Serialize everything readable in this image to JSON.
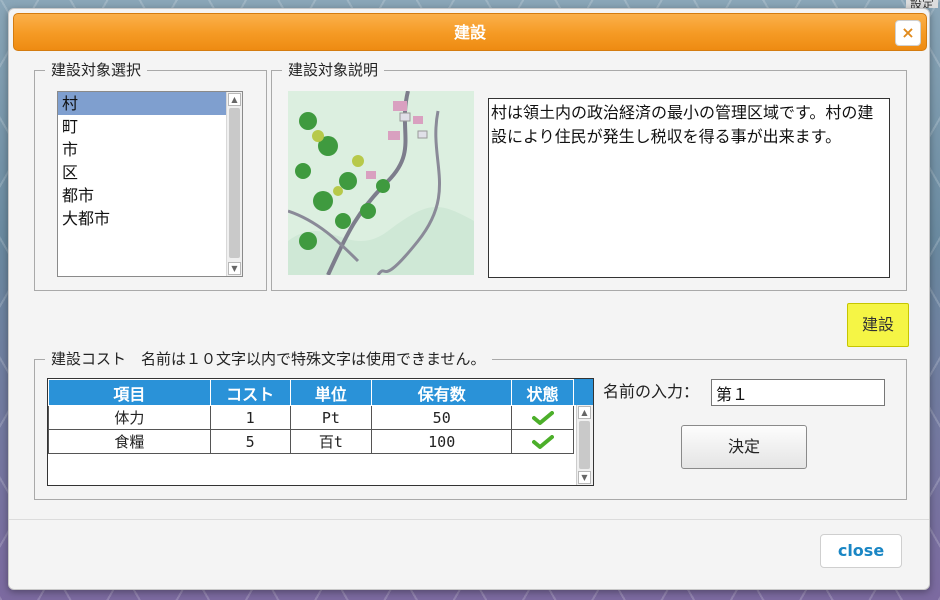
{
  "window": {
    "title": "建設",
    "close_glyph": "×",
    "background_tag": "設定"
  },
  "target_select": {
    "legend": "建設対象選択",
    "items": [
      "村",
      "町",
      "市",
      "区",
      "都市",
      "大都市"
    ],
    "selected_index": 0
  },
  "target_description": {
    "legend": "建設対象説明",
    "text": "村は領土内の政治経済の最小の管理区域です。村の建設により住民が発生し税収を得る事が出来ます。"
  },
  "build_button_label": "建設",
  "cost": {
    "legend": "建設コスト　名前は１０文字以内で特殊文字は使用できません。",
    "headers": [
      "項目",
      "コスト",
      "単位",
      "保有数",
      "状態"
    ],
    "rows": [
      {
        "item": "体力",
        "cost": "1",
        "unit": "Pt",
        "held": "50",
        "status_icon": "check-icon"
      },
      {
        "item": "食糧",
        "cost": "5",
        "unit": "百t",
        "held": "100",
        "status_icon": "check-icon"
      }
    ]
  },
  "name_input": {
    "label": "名前の入力：",
    "value": "第１"
  },
  "decide_button_label": "決定",
  "close_button_label": "close",
  "colors": {
    "title_bar": "#f59a24",
    "table_header": "#2a92d8",
    "build_button": "#f5f545",
    "check": "#4caf2a",
    "close_text": "#1a86c4"
  }
}
